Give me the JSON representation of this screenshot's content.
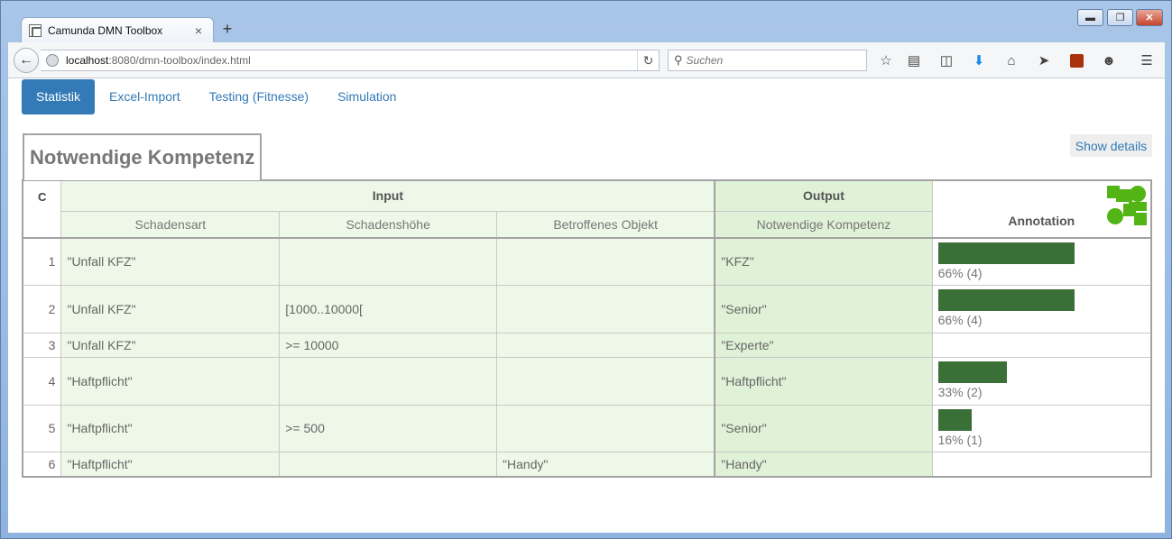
{
  "browser": {
    "tab_title": "Camunda DMN Toolbox",
    "tab_close": "×",
    "new_tab": "+",
    "url_host": "localhost",
    "url_path": ":8080/dmn-toolbox/index.html",
    "search_placeholder": "Suchen",
    "window_min": "▬",
    "window_max": "❐",
    "window_close": "✕"
  },
  "nav": {
    "tabs": [
      {
        "label": "Statistik"
      },
      {
        "label": "Excel-Import"
      },
      {
        "label": "Testing (Fitnesse)"
      },
      {
        "label": "Simulation"
      }
    ]
  },
  "show_details": "Show details",
  "decision": {
    "title": "Notwendige Kompetenz",
    "hit_policy": "C",
    "input_header": "Input",
    "output_header": "Output",
    "annotation_header": "Annotation",
    "columns": {
      "input1": "Schadensart",
      "input2": "Schadenshöhe",
      "input3": "Betroffenes Objekt",
      "output": "Notwendige Kompetenz"
    },
    "rows": [
      {
        "n": "1",
        "i1": "\"Unfall KFZ\"",
        "i2": "",
        "i3": "",
        "out": "\"KFZ\"",
        "pct_label": "66% (4)",
        "pct": 0.66
      },
      {
        "n": "2",
        "i1": "\"Unfall KFZ\"",
        "i2": "[1000..10000[",
        "i3": "",
        "out": "\"Senior\"",
        "pct_label": "66% (4)",
        "pct": 0.66
      },
      {
        "n": "3",
        "i1": "\"Unfall KFZ\"",
        "i2": ">= 10000",
        "i3": "",
        "out": "\"Experte\"",
        "pct_label": "",
        "pct": 0
      },
      {
        "n": "4",
        "i1": "\"Haftpflicht\"",
        "i2": "",
        "i3": "",
        "out": "\"Haftpflicht\"",
        "pct_label": "33% (2)",
        "pct": 0.33
      },
      {
        "n": "5",
        "i1": "\"Haftpflicht\"",
        "i2": ">= 500",
        "i3": "",
        "out": "\"Senior\"",
        "pct_label": "16% (1)",
        "pct": 0.16
      },
      {
        "n": "6",
        "i1": "\"Haftpflicht\"",
        "i2": "",
        "i3": "\"Handy\"",
        "out": "\"Handy\"",
        "pct_label": "",
        "pct": 0
      }
    ]
  },
  "colors": {
    "accent": "#337ab7",
    "bar": "#3a7038",
    "input_bg": "#eef8e8",
    "output_bg": "#dff1d6",
    "logo": "#52b415"
  }
}
